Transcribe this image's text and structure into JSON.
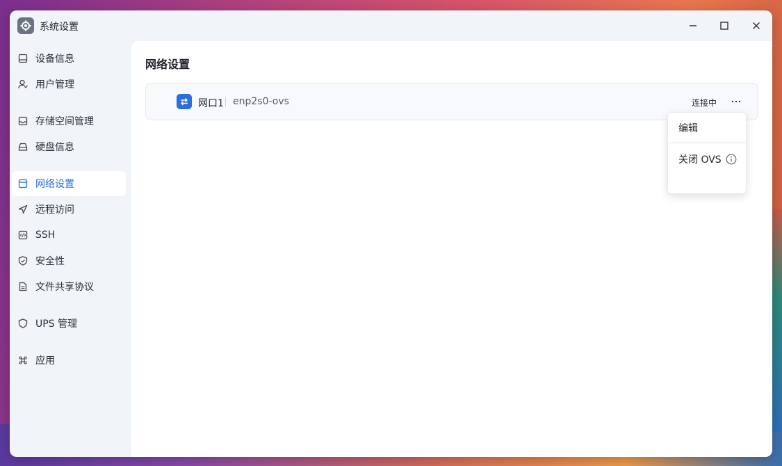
{
  "window": {
    "title": "系统设置"
  },
  "sidebar": {
    "items": [
      {
        "label": "设备信息",
        "icon": "device-icon"
      },
      {
        "label": "用户管理",
        "icon": "user-icon"
      },
      {
        "label": "存储空间管理",
        "icon": "storage-icon"
      },
      {
        "label": "硬盘信息",
        "icon": "disk-icon"
      },
      {
        "label": "网络设置",
        "icon": "network-icon",
        "active": true
      },
      {
        "label": "远程访问",
        "icon": "send-icon"
      },
      {
        "label": "SSH",
        "icon": "code-icon"
      },
      {
        "label": "安全性",
        "icon": "shield-check-icon"
      },
      {
        "label": "文件共享协议",
        "icon": "file-icon"
      },
      {
        "label": "UPS 管理",
        "icon": "shield-icon"
      },
      {
        "label": "应用",
        "icon": "command-icon"
      }
    ]
  },
  "main": {
    "title": "网络设置",
    "interface": {
      "name": "网口1",
      "device": "enp2s0-ovs",
      "status": "连接中"
    },
    "menu": {
      "edit": "编辑",
      "close_ovs": "关闭 OVS"
    }
  },
  "colors": {
    "accent": "#2a6fdb"
  }
}
